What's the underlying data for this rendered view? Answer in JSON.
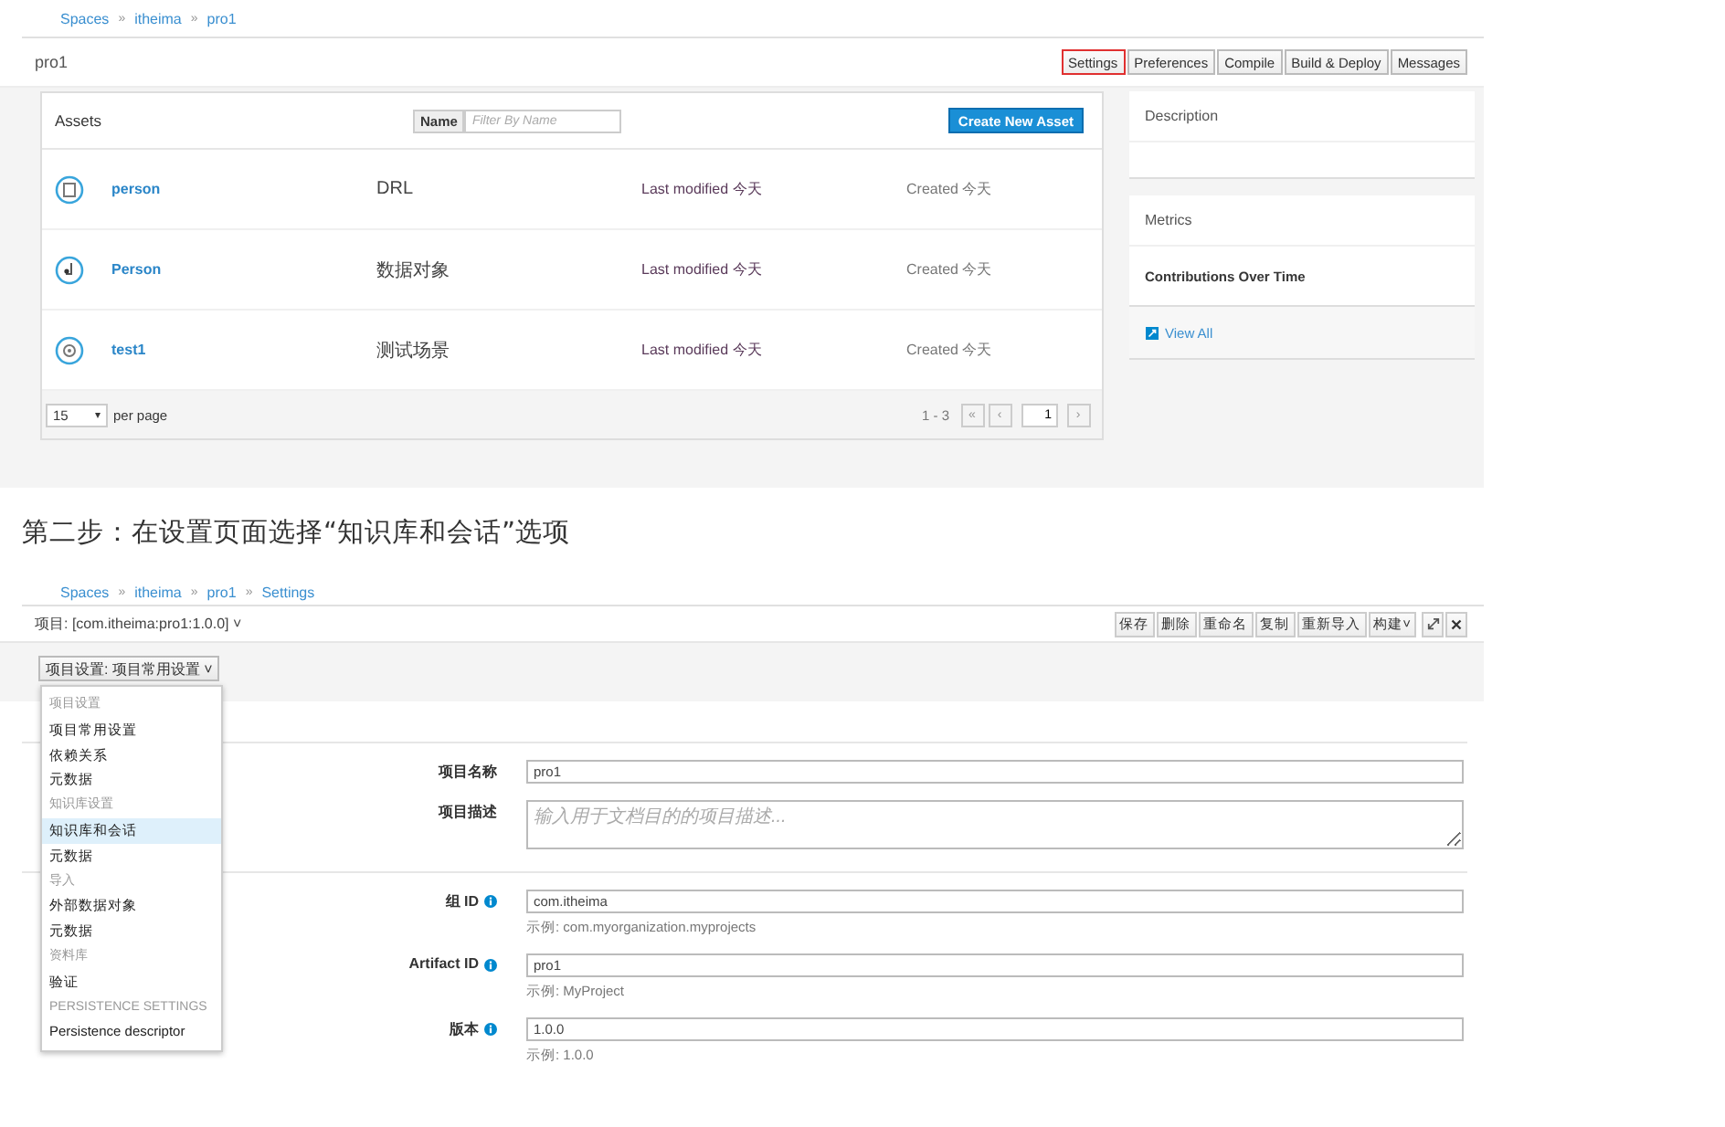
{
  "shot1": {
    "breadcrumb": [
      "Spaces",
      "itheima",
      "pro1"
    ],
    "separator": "»",
    "title": "pro1",
    "buttons": [
      {
        "label": "Settings",
        "highlighted": true
      },
      {
        "label": "Preferences",
        "highlighted": false
      },
      {
        "label": "Compile",
        "highlighted": false
      },
      {
        "label": "Build & Deploy",
        "highlighted": false
      },
      {
        "label": "Messages",
        "highlighted": false
      }
    ],
    "assets": {
      "title": "Assets",
      "filter_label": "Name",
      "filter_placeholder": "Filter By Name",
      "create_button": "Create New Asset",
      "rows": [
        {
          "kind": "drl",
          "name": "person",
          "type": "DRL",
          "modified": "Last modified 今天",
          "created": "Created 今天"
        },
        {
          "kind": "data-object",
          "name": "Person",
          "type": "数据对象",
          "modified": "Last modified 今天",
          "created": "Created 今天"
        },
        {
          "kind": "test-scenario",
          "name": "test1",
          "type": "测试场景",
          "modified": "Last modified 今天",
          "created": "Created 今天"
        }
      ],
      "page_size": "15",
      "page_size_caret": "▾",
      "per_page": "per page",
      "range": "1 - 3",
      "first": "«",
      "prev": "‹",
      "page": "1",
      "next": "›"
    },
    "description": {
      "title": "Description"
    },
    "metrics": {
      "title": "Metrics",
      "subtitle": "Contributions Over Time",
      "link": "View All"
    }
  },
  "caption": "第二步：在设置页面选择“知识库和会话”选项",
  "shot2": {
    "breadcrumb": [
      "Spaces",
      "itheima",
      "pro1",
      "Settings"
    ],
    "separator": "»",
    "project": "项目: [com.itheima:pro1:1.0.0]",
    "project_caret": "˅",
    "toolbar": [
      {
        "label": "保存"
      },
      {
        "label": "删除"
      },
      {
        "label": "重命名"
      },
      {
        "label": "复制"
      },
      {
        "label": "重新导入"
      },
      {
        "label": "构建",
        "caret": "˅"
      }
    ],
    "settings_dropdown": "项目设置: 项目常用设置",
    "settings_dropdown_caret": "˅",
    "menu": [
      {
        "kind": "header",
        "label": "项目设置",
        "selected": false
      },
      {
        "kind": "item",
        "label": "项目常用设置",
        "selected": false
      },
      {
        "kind": "item",
        "label": "依赖关系",
        "selected": false
      },
      {
        "kind": "item",
        "label": "元数据",
        "selected": false
      },
      {
        "kind": "header",
        "label": "知识库设置",
        "selected": false
      },
      {
        "kind": "item",
        "label": "知识库和会话",
        "selected": true
      },
      {
        "kind": "item",
        "label": "元数据",
        "selected": false
      },
      {
        "kind": "header",
        "label": "导入",
        "selected": false
      },
      {
        "kind": "item",
        "label": "外部数据对象",
        "selected": false
      },
      {
        "kind": "item",
        "label": "元数据",
        "selected": false
      },
      {
        "kind": "header",
        "label": "资料库",
        "selected": false
      },
      {
        "kind": "item",
        "label": "验证",
        "selected": false
      },
      {
        "kind": "header",
        "label": "PERSISTENCE SETTINGS",
        "selected": false
      },
      {
        "kind": "item",
        "label": "Persistence descriptor",
        "selected": false
      }
    ],
    "sections": [
      [
        {
          "kind": "input",
          "label": "项目名称",
          "info": false,
          "value": "pro1"
        },
        {
          "kind": "textarea",
          "label": "项目描述",
          "info": false,
          "placeholder": "输入用于文档目的的项目描述..."
        }
      ],
      [
        {
          "kind": "input",
          "label": "组 ID",
          "info": true,
          "value": "com.itheima",
          "hint": "示例: com.myorganization.myprojects"
        },
        {
          "kind": "input",
          "label": "Artifact ID",
          "info": true,
          "value": "pro1",
          "hint": "示例: MyProject"
        },
        {
          "kind": "input",
          "label": "版本",
          "info": true,
          "value": "1.0.0",
          "hint": "示例:  1.0.0"
        }
      ]
    ]
  }
}
